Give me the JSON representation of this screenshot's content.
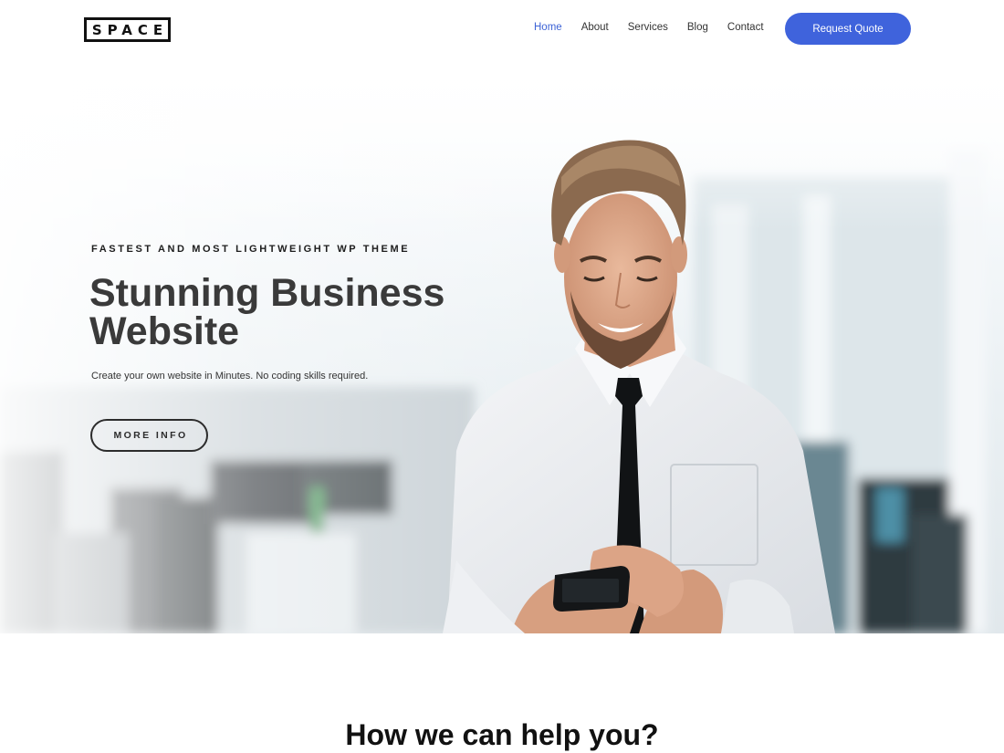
{
  "brand": {
    "logo_text": "SPACE"
  },
  "nav": {
    "items": [
      {
        "label": "Home",
        "active": true
      },
      {
        "label": "About",
        "active": false
      },
      {
        "label": "Services",
        "active": false
      },
      {
        "label": "Blog",
        "active": false
      },
      {
        "label": "Contact",
        "active": false
      }
    ],
    "cta_label": "Request Quote"
  },
  "hero": {
    "eyebrow": "FASTEST AND MOST LIGHTWEIGHT WP THEME",
    "headline": "Stunning Business Website",
    "subtext": "Create your own website in Minutes. No coding skills required.",
    "button_label": "MORE INFO"
  },
  "section": {
    "title": "How we can help you?"
  },
  "colors": {
    "accent": "#3f63dc",
    "nav_active": "#3d63d6",
    "heading": "#3a3a3a"
  }
}
